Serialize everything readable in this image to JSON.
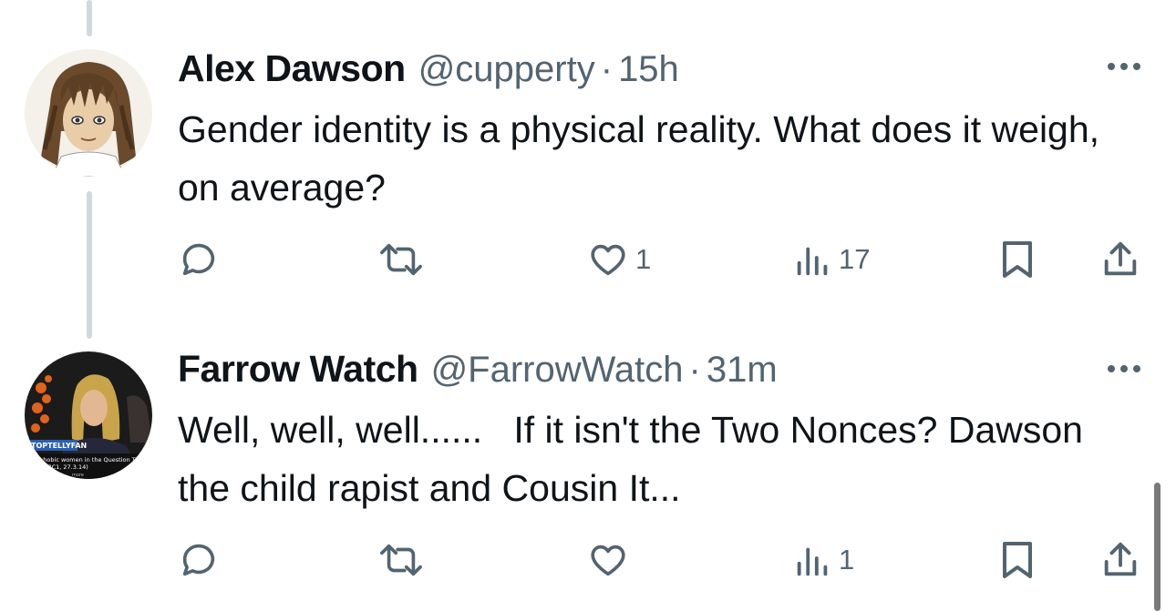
{
  "tweets": [
    {
      "name": "Alex Dawson",
      "handle": "@cupperty",
      "separator": "·",
      "time": "15h",
      "text": "Gender identity is a physical reality. What does it weigh, on average?",
      "likes": "1",
      "views": "17",
      "avatar": "cartoon-person-long-brown-hair"
    },
    {
      "name": "Farrow Watch",
      "handle": "@FarrowWatch",
      "separator": "·",
      "time": "31m",
      "text": "Well, well, well......   If it isn't the Two Nonces? Dawson the child rapist and Cousin It...",
      "likes": "",
      "views": "1",
      "avatar": "tv-screenshot-blonde-woman",
      "avatar_caption_logo": "TOPTELLYFAN",
      "avatar_caption_line1": "...ophobic women in the Question T...",
      "avatar_caption_line2": "...e (BBC1, 27.3.14)",
      "avatar_caption_more": "more"
    }
  ],
  "colors": {
    "text": "#0f1419",
    "muted": "#536471",
    "thread_line": "#cfd9de"
  },
  "icons": [
    "reply-icon",
    "retweet-icon",
    "like-icon",
    "views-icon",
    "bookmark-icon",
    "share-icon",
    "more-icon"
  ]
}
